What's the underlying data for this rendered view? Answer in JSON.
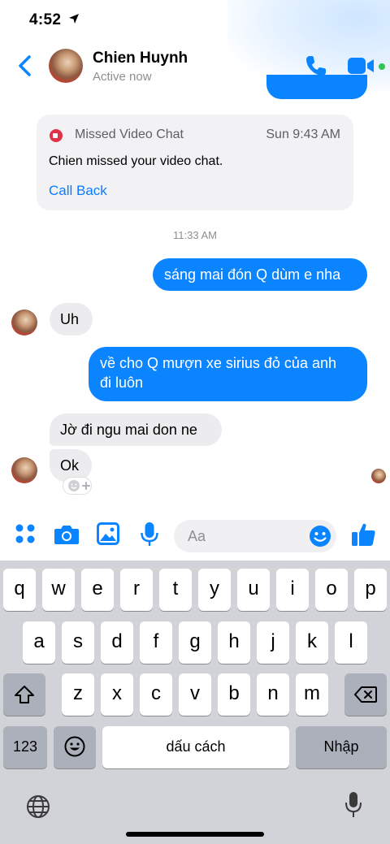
{
  "status_bar": {
    "time": "4:52"
  },
  "header": {
    "contact_name": "Chien Huynh",
    "contact_status": "Active now",
    "back_icon": "chevron-left-icon",
    "call_icon": "phone-icon",
    "video_icon": "video-camera-icon"
  },
  "colors": {
    "accent": "#0a84ff",
    "incoming_bubble": "#ececee",
    "missed_red": "#e0324a",
    "online": "#31c553"
  },
  "missed_call": {
    "title": "Missed Video Chat",
    "time": "Sun 9:43 AM",
    "body": "Chien missed your video chat.",
    "action": "Call Back"
  },
  "timestamp": "11:33 AM",
  "messages": [
    {
      "direction": "out",
      "text": "sáng mai đón Q dùm e nha"
    },
    {
      "direction": "in",
      "text": "Uh"
    },
    {
      "direction": "out",
      "lines": [
        "về cho Q mượn xe sirius đỏ của anh",
        "đi luôn"
      ]
    },
    {
      "direction": "in",
      "text": "Jờ đi ngu mai don ne"
    },
    {
      "direction": "in",
      "text": "Ok"
    }
  ],
  "composer": {
    "placeholder": "Aa"
  },
  "keyboard": {
    "row1": [
      "q",
      "w",
      "e",
      "r",
      "t",
      "y",
      "u",
      "i",
      "o",
      "p"
    ],
    "row2": [
      "a",
      "s",
      "d",
      "f",
      "g",
      "h",
      "j",
      "k",
      "l"
    ],
    "row3": [
      "z",
      "x",
      "c",
      "v",
      "b",
      "n",
      "m"
    ],
    "numbers_key": "123",
    "space_key": "dấu cách",
    "return_key": "Nhập"
  }
}
